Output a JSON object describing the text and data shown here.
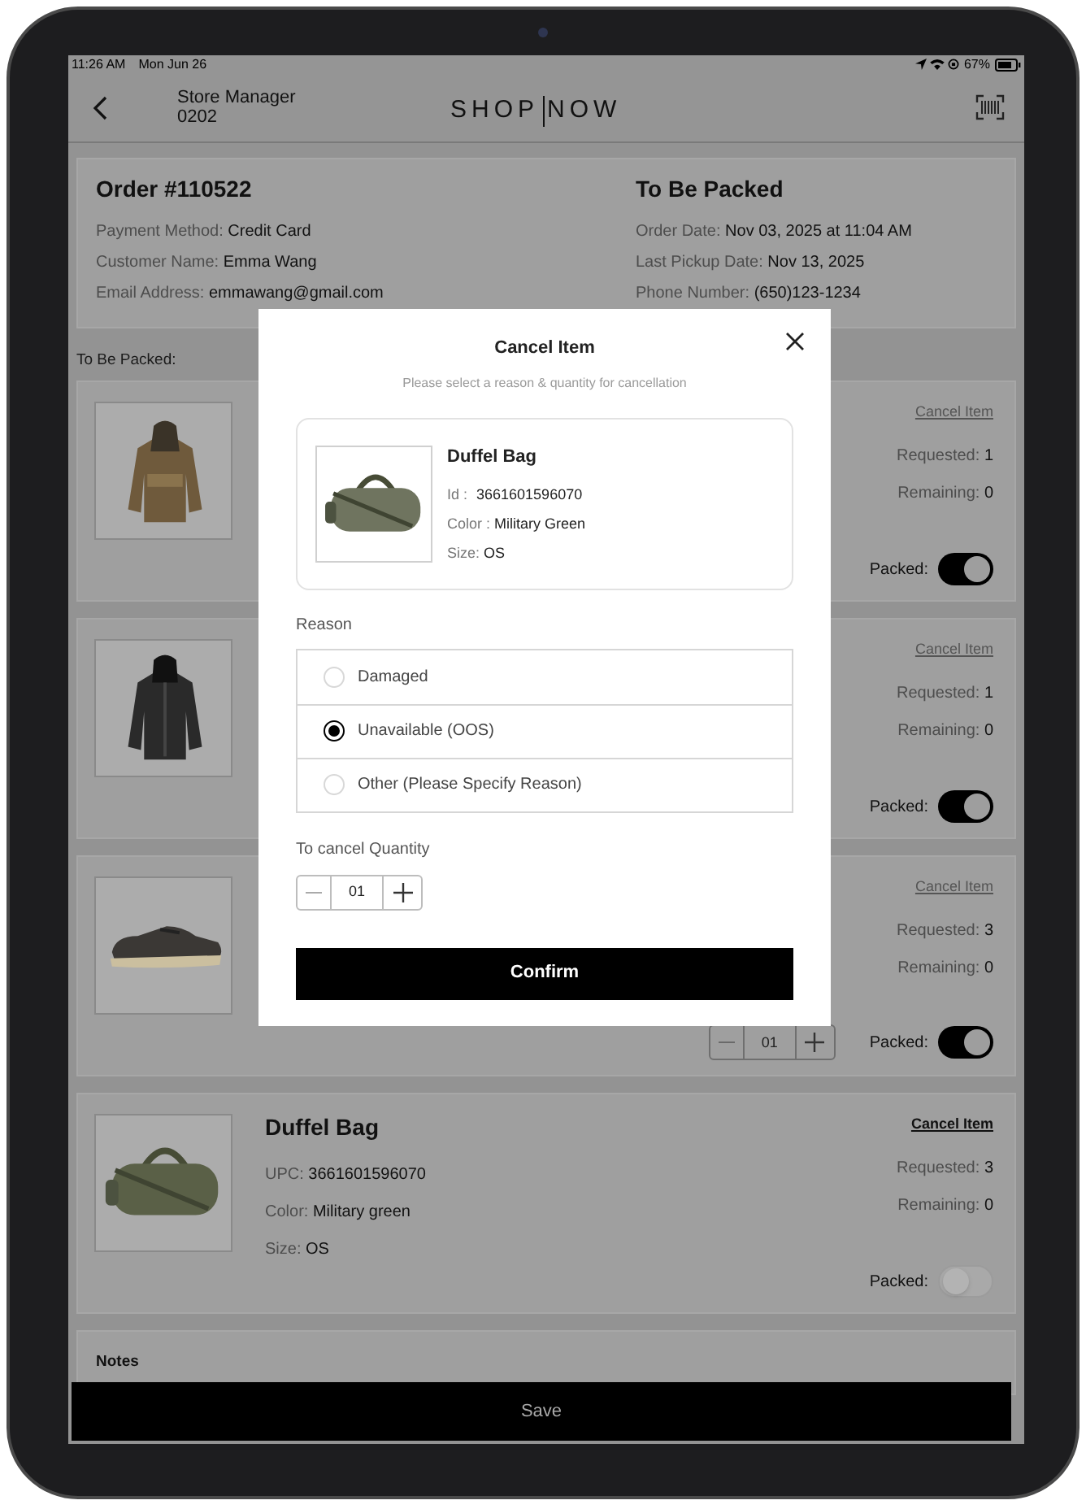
{
  "status_bar": {
    "time": "11:26 AM",
    "date": "Mon Jun 26",
    "battery": "67%"
  },
  "header": {
    "title": "Store Manager",
    "subtitle": "0202",
    "logo_left": "SHOP",
    "logo_right": "NOW"
  },
  "order": {
    "number": "Order #110522",
    "status": "To Be Packed",
    "fields": [
      {
        "label": "Payment Method:",
        "value": "Credit Card"
      },
      {
        "label": "Order Date:",
        "value": "Nov 03, 2025 at 11:04 AM"
      },
      {
        "label": "Customer Name:",
        "value": "Emma Wang"
      },
      {
        "label": "Last Pickup Date:",
        "value": "Nov 13, 2025"
      },
      {
        "label": "Email Address:",
        "value": "emmawang@gmail.com"
      },
      {
        "label": "Phone Number:",
        "value": "(650)123-1234"
      }
    ]
  },
  "section_label": "To Be Packed:",
  "items": [
    {
      "kind": "jacket",
      "cancel_label": "Cancel Item",
      "cancel_active": false,
      "requested_label": "Requested:",
      "requested": "1",
      "remaining_label": "Remaining:",
      "remaining": "0",
      "packed_label": "Packed:",
      "packed": true
    },
    {
      "kind": "jacket-dark",
      "cancel_label": "Cancel Item",
      "cancel_active": false,
      "requested_label": "Requested:",
      "requested": "1",
      "remaining_label": "Remaining:",
      "remaining": "0",
      "packed_label": "Packed:",
      "packed": true
    },
    {
      "kind": "shoe",
      "cancel_label": "Cancel Item",
      "cancel_active": false,
      "requested_label": "Requested:",
      "requested": "3",
      "remaining_label": "Remaining:",
      "remaining": "0",
      "quantity": "01",
      "packed_label": "Packed:",
      "packed": true
    },
    {
      "kind": "bag",
      "name": "Duffel Bag",
      "details": [
        {
          "label": "UPC:",
          "value": "3661601596070"
        },
        {
          "label": "Color:",
          "value": "Military green"
        },
        {
          "label": "Size:",
          "value": "OS"
        }
      ],
      "cancel_label": "Cancel Item",
      "cancel_active": true,
      "requested_label": "Requested:",
      "requested": "3",
      "remaining_label": "Remaining:",
      "remaining": "0",
      "packed_label": "Packed:",
      "packed": false
    }
  ],
  "notes": {
    "title": "Notes"
  },
  "save_button": "Save",
  "modal": {
    "title": "Cancel Item",
    "subtitle": "Please select a reason & quantity for cancellation",
    "product": {
      "name": "Duffel Bag",
      "details": [
        {
          "label": "Id :",
          "value": "3661601596070"
        },
        {
          "label": "Color :",
          "value": "Military Green"
        },
        {
          "label": "Size:",
          "value": "OS"
        }
      ]
    },
    "reason_label": "Reason",
    "reasons": [
      {
        "label": "Damaged",
        "selected": false
      },
      {
        "label": "Unavailable (OOS)",
        "selected": true
      },
      {
        "label": "Other (Please Specify Reason)",
        "selected": false
      }
    ],
    "quantity_label": "To cancel Quantity",
    "quantity": "01",
    "confirm_button": "Confirm"
  }
}
